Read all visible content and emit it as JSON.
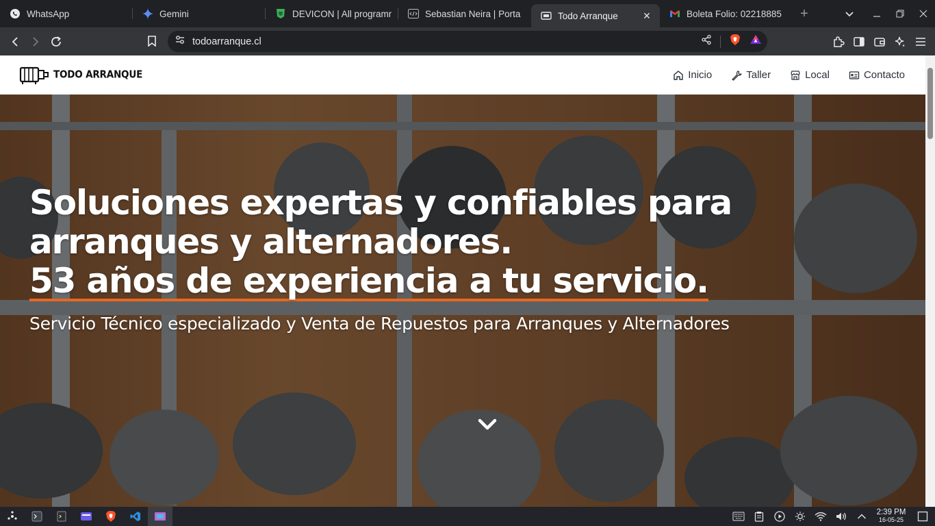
{
  "browser": {
    "tabs": [
      {
        "title": "WhatsApp",
        "icon": "whatsapp-icon",
        "active": false
      },
      {
        "title": "Gemini",
        "icon": "gemini-icon",
        "active": false
      },
      {
        "title": "DEVICON | All programm",
        "icon": "devicon-icon",
        "active": false
      },
      {
        "title": "Sebastian Neira | Porta",
        "icon": "code-icon",
        "active": false
      },
      {
        "title": "Todo Arranque",
        "icon": "todoarranque-favicon",
        "active": true
      },
      {
        "title": "Boleta Folio: 02218885",
        "icon": "gmail-icon",
        "active": false
      }
    ],
    "url": "todoarranque.cl"
  },
  "site": {
    "logo_text": "TODO ARRANQUE",
    "nav": [
      {
        "label": "Inicio",
        "icon": "home-icon"
      },
      {
        "label": "Taller",
        "icon": "wrench-icon"
      },
      {
        "label": "Local",
        "icon": "store-icon"
      },
      {
        "label": "Contacto",
        "icon": "contact-card-icon"
      }
    ],
    "hero": {
      "line1": "Soluciones expertas y confiables para",
      "line2": "arranques y alternadores.",
      "line3": "53 años de experiencia a tu servicio.",
      "subtitle": "Servicio Técnico especializado y Venta de Repuestos para Arranques y Alternadores",
      "accent_color": "#e8681e"
    }
  },
  "taskbar": {
    "time": "2:39 PM",
    "date": "16-05-25"
  }
}
